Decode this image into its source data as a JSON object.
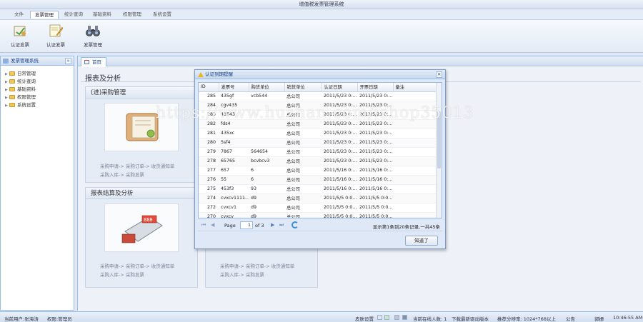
{
  "app": {
    "title": "增值税发票管理系统"
  },
  "menu": [
    "文件",
    "发票管理",
    "统计查询",
    "基础资料",
    "权限管理",
    "系统设置"
  ],
  "toolbar": [
    {
      "label": "认证发票",
      "icon": "certify-invoice-icon"
    },
    {
      "label": "认证发票",
      "icon": "edit-invoice-icon"
    },
    {
      "label": "发票管理",
      "icon": "binoculars-icon"
    }
  ],
  "sidebar": {
    "title": "发票管理系统",
    "items": [
      "日常管理",
      "统计查询",
      "基础资料",
      "权限管理",
      "系统设置"
    ]
  },
  "tabs": [
    {
      "label": "首页"
    }
  ],
  "main": {
    "title": "报表及分析",
    "cards": [
      {
        "title": "(进)采购管理",
        "line1": "采购申请-> 采购订单-> 收货通知单",
        "line2": "采购入库-> 采购发票"
      },
      {
        "title": "报表结算及分析",
        "line1": "采购申请-> 采购订单-> 收货通知单",
        "line2": "采购入库-> 采购发票"
      },
      {
        "title": "",
        "line1": "采购申请-> 采购订单-> 收货通知单",
        "line2": "采购入库-> 采购发票"
      }
    ]
  },
  "dialog": {
    "title": "认证到期提醒",
    "columns": [
      "ID",
      "发票号",
      "购货单位",
      "销货单位",
      "认证日期",
      "开票日期",
      "备注"
    ],
    "rows": [
      [
        "285",
        "435gf",
        "vcb544",
        "总公司",
        "2011/5/23 0:...",
        "2011/5/23 0:...",
        ""
      ],
      [
        "284",
        "cgv435",
        "",
        "总公司",
        "2011/5/23 0:...",
        "2011/5/23 0:...",
        ""
      ],
      [
        "283",
        "43543",
        "",
        "总公司",
        "2011/5/23 0:...",
        "2011/5/23 0:...",
        ""
      ],
      [
        "282",
        "fds4",
        "",
        "总公司",
        "2011/5/23 0:...",
        "2011/5/23 0:...",
        ""
      ],
      [
        "281",
        "435xc",
        "",
        "总公司",
        "2011/5/23 0:...",
        "2011/5/23 0:...",
        ""
      ],
      [
        "280",
        "5sf4",
        "",
        "总公司",
        "2011/5/23 0:...",
        "2011/5/23 0:...",
        ""
      ],
      [
        "279",
        "7867",
        "564654",
        "总公司",
        "2011/5/23 0:...",
        "2011/5/23 0:...",
        ""
      ],
      [
        "278",
        "65765",
        "bcvbcv3",
        "总公司",
        "2011/5/23 0:...",
        "2011/5/23 0:...",
        ""
      ],
      [
        "277",
        "657",
        "6",
        "总公司",
        "2011/5/16 0:...",
        "2011/5/16 0:...",
        ""
      ],
      [
        "276",
        "55",
        "6",
        "总公司",
        "2011/5/16 0:...",
        "2011/5/16 0:...",
        ""
      ],
      [
        "275",
        "453f3",
        "93",
        "总公司",
        "2011/5/16 0:...",
        "2011/5/16 0:...",
        ""
      ],
      [
        "274",
        "cvxcv1111...",
        "d9",
        "总公司",
        "2011/5/5 0:0...",
        "2011/5/5 0:0...",
        ""
      ],
      [
        "272",
        "cvxcv1",
        "d9",
        "总公司",
        "2011/5/5 0:0...",
        "2011/5/5 0:0...",
        ""
      ],
      [
        "270",
        "cvxcv",
        "d9",
        "总公司",
        "2011/5/5 0:0...",
        "2011/5/5 0:0...",
        ""
      ]
    ],
    "pager": {
      "page_label": "Page",
      "page": "1",
      "of_label": "of 3",
      "info": "显示第1条到20条记录,一共45条"
    },
    "ok_label": "知道了"
  },
  "status": {
    "user": "当前用户:张海涛",
    "role": "权限:管理员",
    "skin": "皮肤设置",
    "online": "当前在线人数: 1",
    "download": "下载最新驱动版本",
    "resolution": "推荐分辨率: 1024*768以上",
    "notice": "公告",
    "unit": "郭栅",
    "time": "10:46:55 AM"
  },
  "watermark": "https://www.huzhan.com/ishop35013",
  "colors": {
    "accent": "#15428b",
    "border": "#99bbe8",
    "background": "#dfe8f6"
  }
}
